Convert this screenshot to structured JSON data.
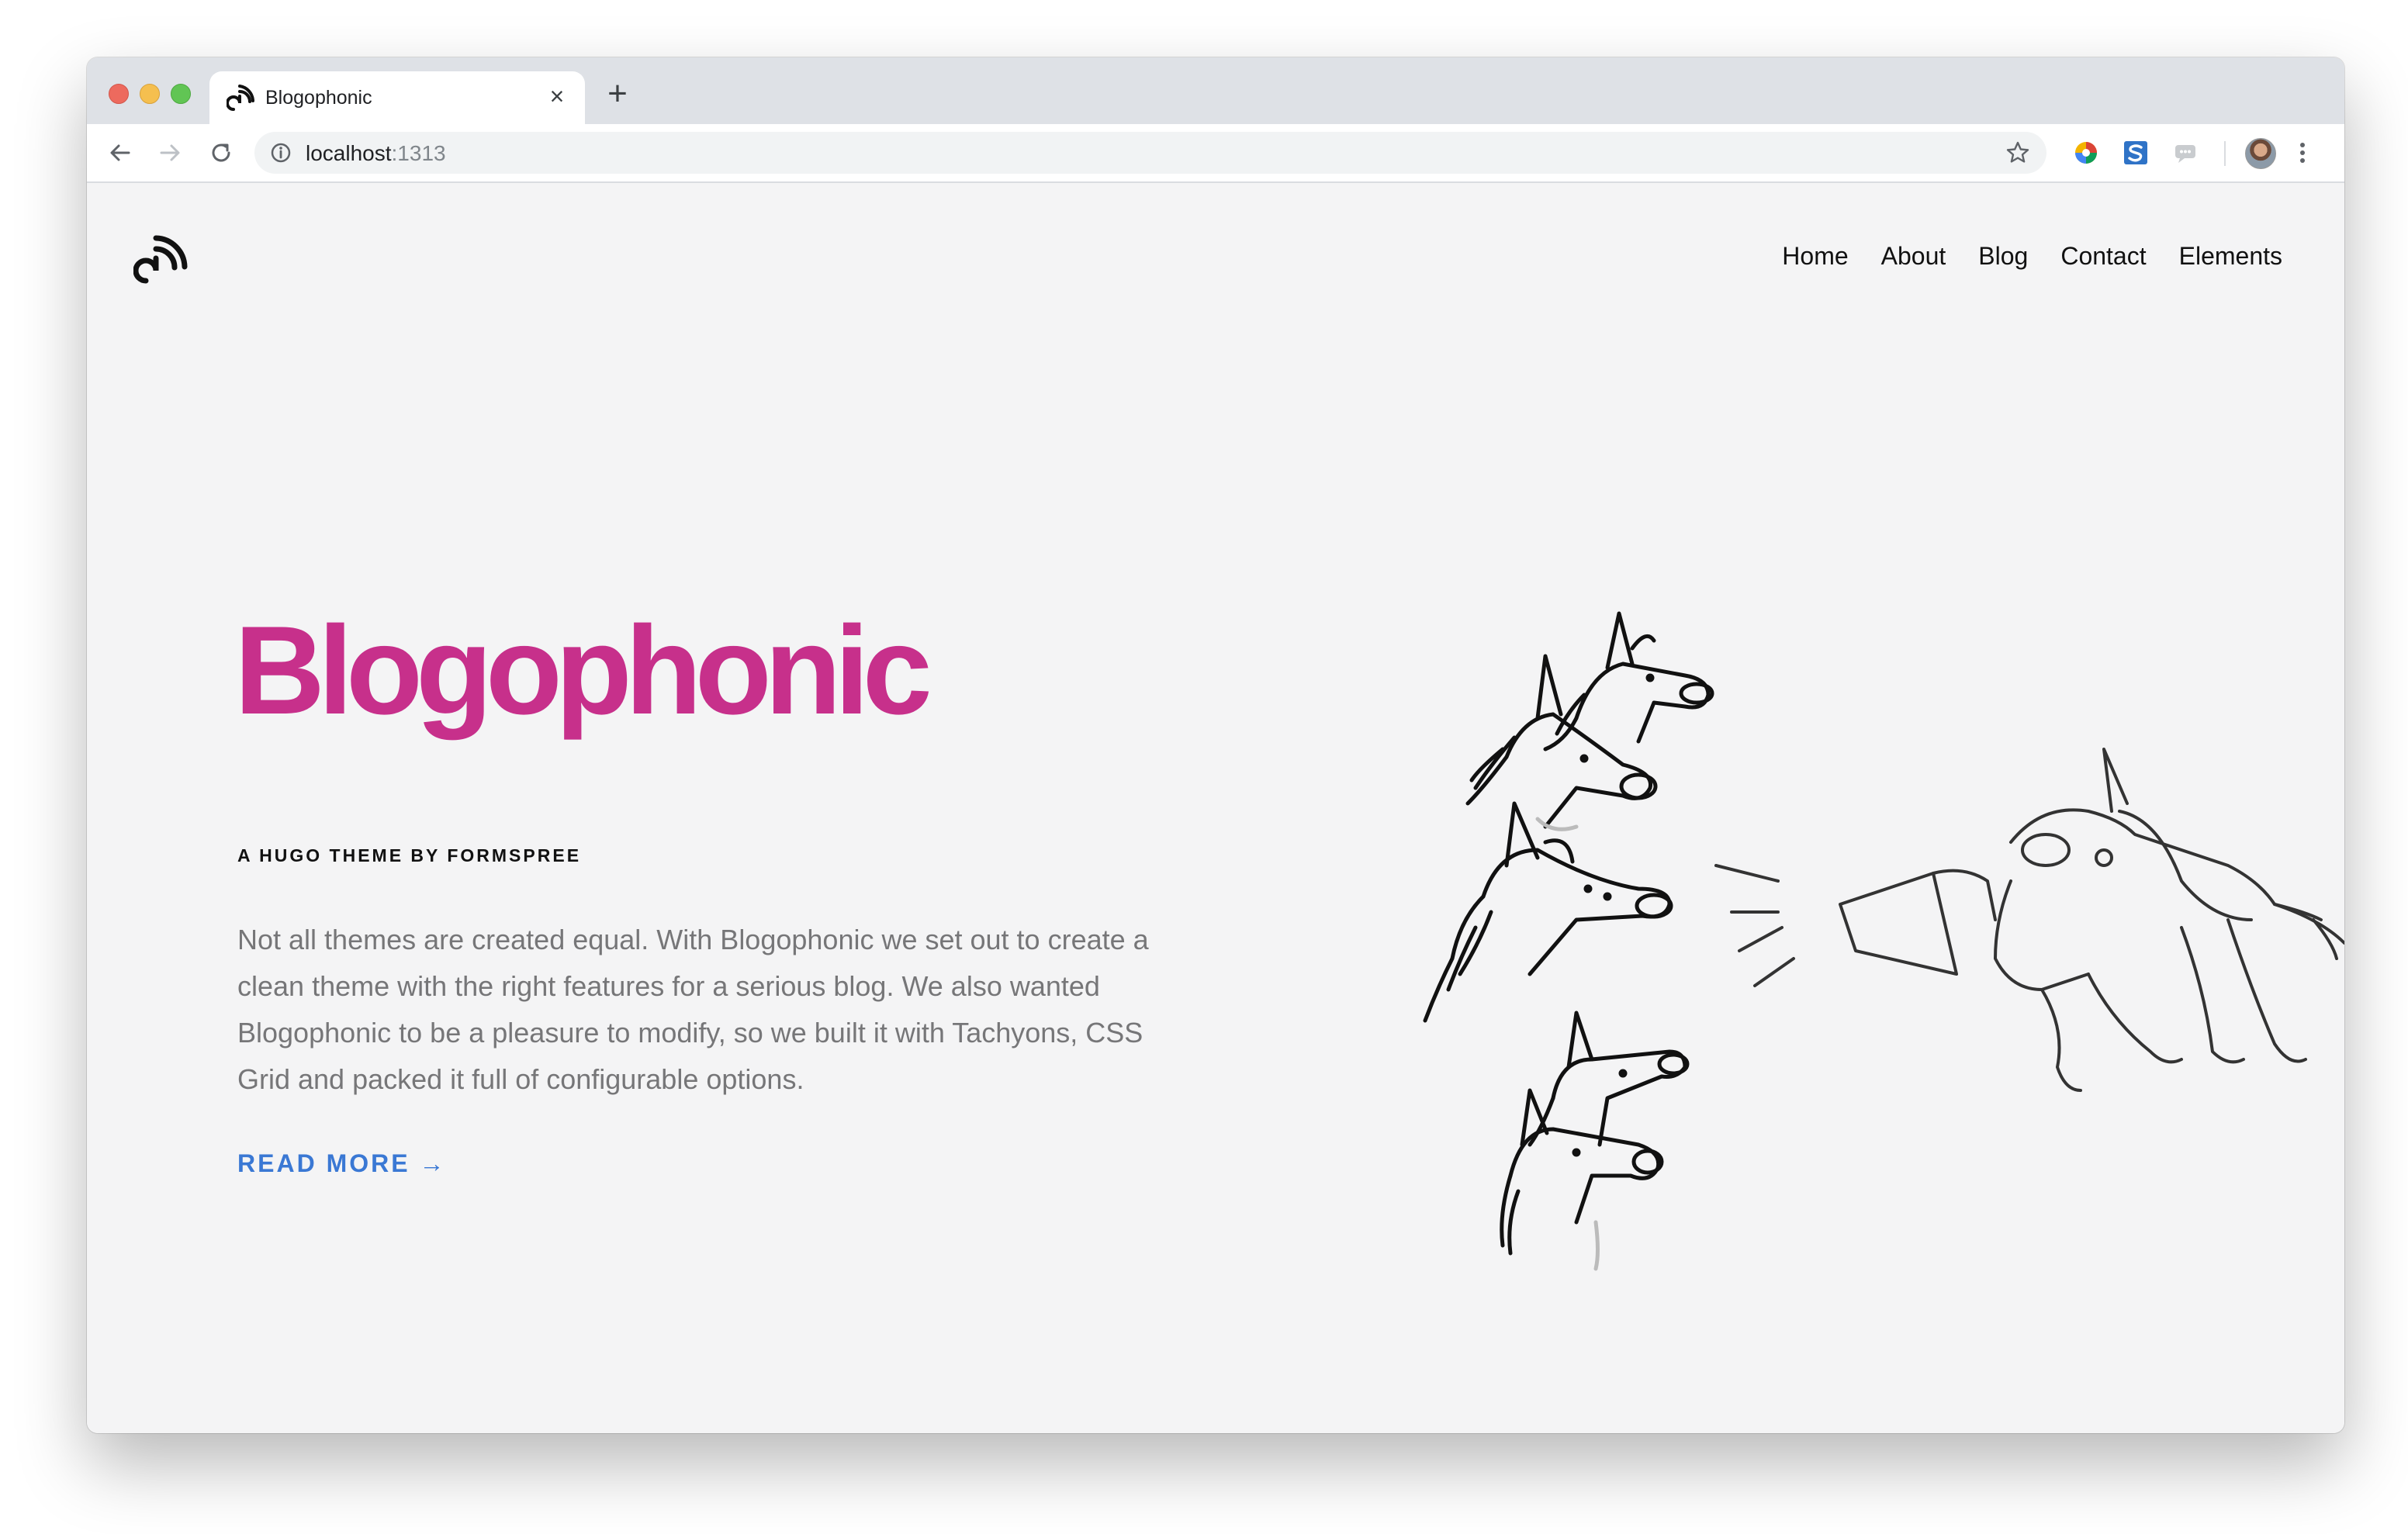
{
  "browser": {
    "tab": {
      "title": "Blogophonic",
      "favicon_icon": "rss-icon"
    },
    "address_bar": {
      "host": "localhost",
      "port": ":1313"
    }
  },
  "site": {
    "logo_icon": "rss-icon",
    "nav": {
      "items": [
        "Home",
        "About",
        "Blog",
        "Contact",
        "Elements"
      ]
    },
    "hero": {
      "title": "Blogophonic",
      "subtitle": "A HUGO THEME BY FORMSPREE",
      "description": "Not all themes are created equal. With Blogophonic we set out to create a clean theme with the right features for a serious blog. We also wanted Blogophonic to be a pleasure to modify, so we built it with Tachyons, CSS Grid and packed it full of configurable options.",
      "cta": "READ MORE →"
    },
    "colors": {
      "title": "#c7308b",
      "link": "#3a78d4",
      "background": "#f4f4f5",
      "body_text": "#767678"
    }
  }
}
